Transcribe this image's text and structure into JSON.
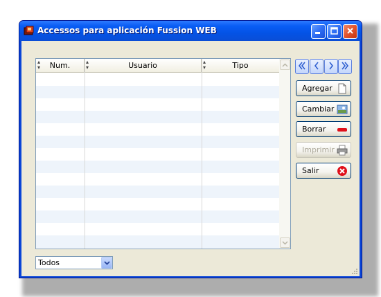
{
  "window": {
    "title": "Accessos para aplicación Fussion WEB",
    "icon": "app-icon",
    "controls": [
      "minimize-icon",
      "maximize-icon",
      "close-icon"
    ]
  },
  "grid": {
    "columns": [
      {
        "label": "Num."
      },
      {
        "label": "Usuario"
      },
      {
        "label": "Tipo"
      }
    ],
    "rows": []
  },
  "navigation": {
    "buttons": [
      "first-record-icon",
      "previous-record-icon",
      "next-record-icon",
      "last-record-icon"
    ]
  },
  "actions": {
    "add": {
      "label": "Agregar",
      "icon": "new-document-icon"
    },
    "change": {
      "label": "Cambiar",
      "icon": "edit-image-icon"
    },
    "delete": {
      "label": "Borrar",
      "icon": "minus-icon"
    },
    "print": {
      "label": "Imprimir",
      "icon": "printer-icon",
      "enabled": false
    },
    "exit": {
      "label": "Salir",
      "icon": "close-circle-icon"
    }
  },
  "filter": {
    "selected": "Todos"
  },
  "colors": {
    "title_bar": "#0a5ef5",
    "client_bg": "#ece9d8",
    "row_alt": "#eef4fb",
    "close_button": "#e3542f"
  }
}
